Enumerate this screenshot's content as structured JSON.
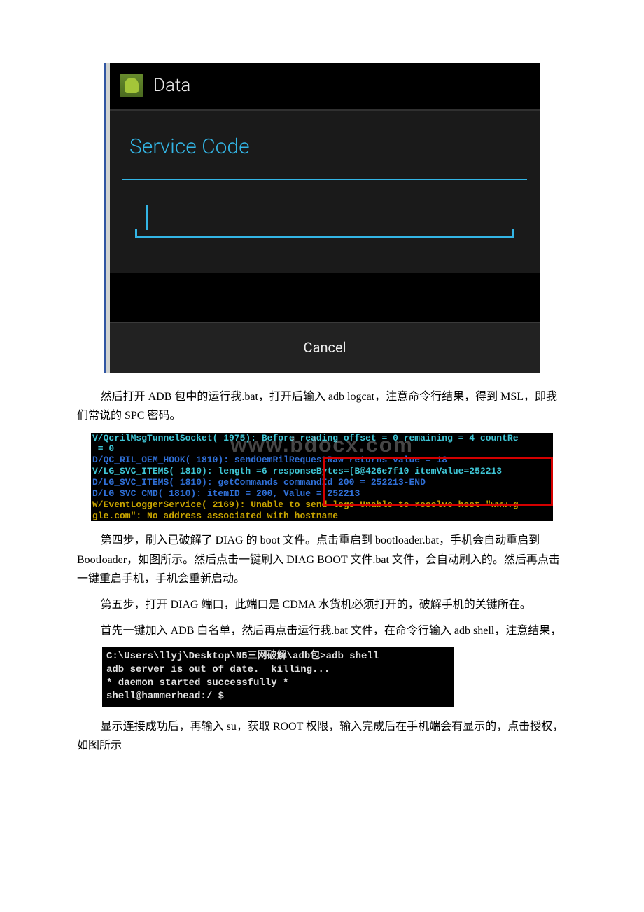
{
  "android": {
    "app_title": "Data",
    "dialog_title": "Service Code",
    "input_value": "",
    "cancel_label": "Cancel"
  },
  "para1": {
    "t1": "然后打开 ADB 包中的运行我.bat，打开后输入 adb logcat，注意命令行结果，得到 MSL，即我们常说的 SPC 密码。"
  },
  "logcat": {
    "lines": [
      {
        "cls": "c-cyan",
        "text": "V/QcrilMsgTunnelSocket( 1975): Before reading offset = 0 remaining = 4 countRe"
      },
      {
        "cls": "c-cyan",
        "text": " = 0"
      },
      {
        "cls": "c-blue",
        "text": "D/QC_RIL_OEM_HOOK( 1810): sendOemRilRequestRaw returns value = 18"
      },
      {
        "cls": "c-cyan",
        "text": "V/LG_SVC_ITEMS( 1810): length =6 responseBytes=[B@426e7f10 itemValue=252213"
      },
      {
        "cls": "c-blue",
        "text": "D/LG_SVC_ITEMS( 1810): getCommands commandId 200 = 252213-END"
      },
      {
        "cls": "c-blue",
        "text": "D/LG_SVC_CMD( 1810): itemID = 200, Value = 252213"
      },
      {
        "cls": "c-yellow",
        "text": "W/EventLoggerService( 2169): Unable to send logs Unable to resolve host \"www.g"
      },
      {
        "cls": "c-yellow",
        "text": "gle.com\": No address associated with hostname"
      }
    ],
    "watermark": "www.bdocx.com"
  },
  "para2": "第四步，刷入已破解了 DIAG 的 boot 文件。点击重启到 bootloader.bat，手机会自动重启到 Bootloader，如图所示。然后点击一键刷入 DIAG BOOT 文件.bat 文件，会自动刷入的。然后再点击一键重启手机，手机会重新启动。",
  "para3": "第五步，打开 DIAG 端口，此端口是 CDMA 水货机必须打开的，破解手机的关键所在。",
  "para4": "首先一键加入 ADB 白名单，然后再点击运行我.bat 文件，在命令行输入 adb shell，注意结果，",
  "cmd": {
    "lines": [
      "C:\\Users\\llyj\\Desktop\\N5三网破解\\adb包>adb shell",
      "adb server is out of date.  killing...",
      "* daemon started successfully *",
      "shell@hammerhead:/ $"
    ]
  },
  "para5": "显示连接成功后，再输入 su，获取 ROOT 权限，输入完成后在手机端会有显示的，点击授权，如图所示"
}
